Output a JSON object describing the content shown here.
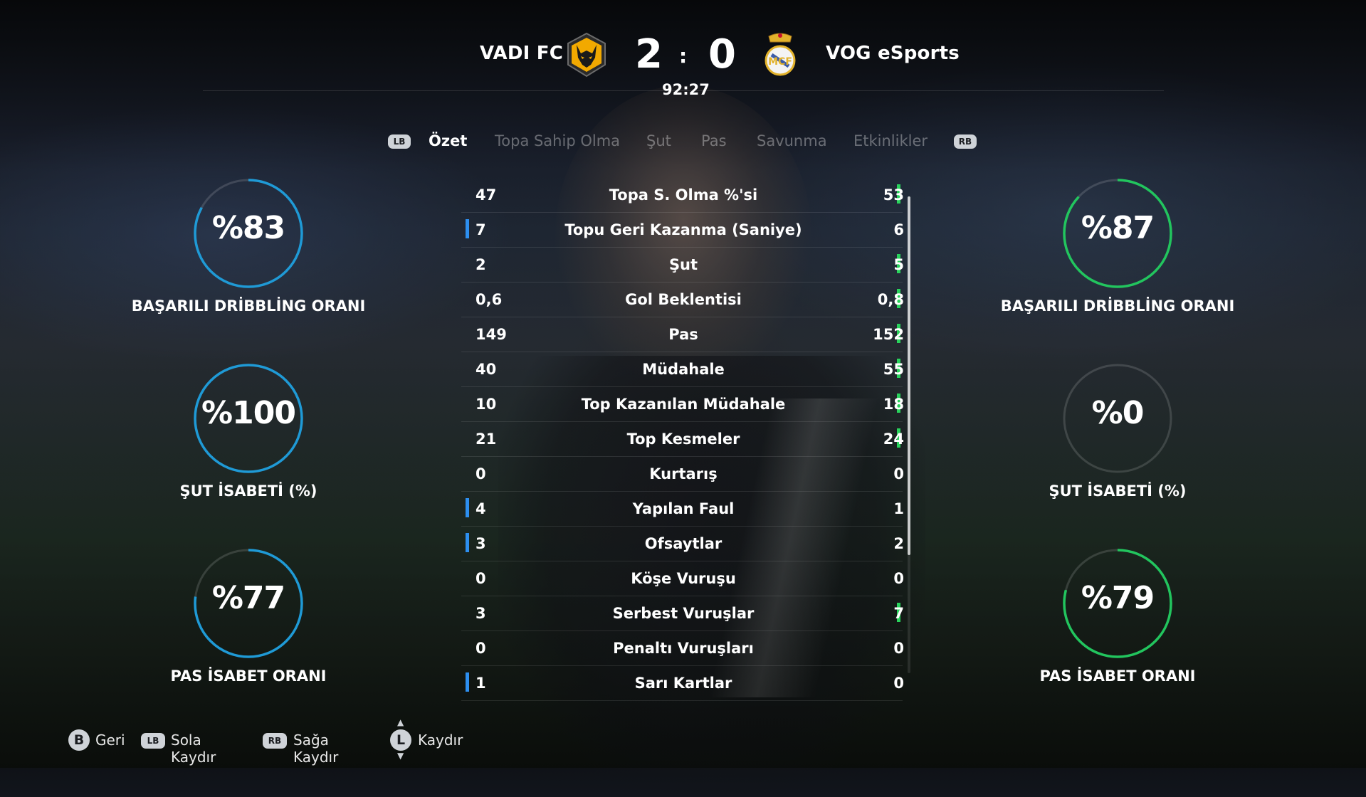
{
  "header": {
    "home_team": "VADI FC",
    "away_team": "VOG eSports",
    "home_score": "2",
    "away_score": "0",
    "separator": ":",
    "clock": "92:27",
    "home_crest_icon": "wolf-crest-icon",
    "away_crest_icon": "real-madrid-crest-icon"
  },
  "tabs": {
    "prev_button": "LB",
    "next_button": "RB",
    "items": [
      {
        "label": "Özet",
        "active": true
      },
      {
        "label": "Topa Sahip Olma",
        "active": false
      },
      {
        "label": "Şut",
        "active": false
      },
      {
        "label": "Pas",
        "active": false
      },
      {
        "label": "Savunma",
        "active": false
      },
      {
        "label": "Etkinlikler",
        "active": false
      }
    ]
  },
  "stats": [
    {
      "label": "Topa S. Olma %'si",
      "home": "47",
      "away": "53",
      "leader": "away"
    },
    {
      "label": "Topu Geri Kazanma (Saniye)",
      "home": "7",
      "away": "6",
      "leader": "home"
    },
    {
      "label": "Şut",
      "home": "2",
      "away": "5",
      "leader": "away"
    },
    {
      "label": "Gol Beklentisi",
      "home": "0,6",
      "away": "0,8",
      "leader": "away"
    },
    {
      "label": "Pas",
      "home": "149",
      "away": "152",
      "leader": "away"
    },
    {
      "label": "Müdahale",
      "home": "40",
      "away": "55",
      "leader": "away"
    },
    {
      "label": "Top Kazanılan Müdahale",
      "home": "10",
      "away": "18",
      "leader": "away"
    },
    {
      "label": "Top Kesmeler",
      "home": "21",
      "away": "24",
      "leader": "away"
    },
    {
      "label": "Kurtarış",
      "home": "0",
      "away": "0",
      "leader": "none"
    },
    {
      "label": "Yapılan Faul",
      "home": "4",
      "away": "1",
      "leader": "home"
    },
    {
      "label": "Ofsaytlar",
      "home": "3",
      "away": "2",
      "leader": "home"
    },
    {
      "label": "Köşe Vuruşu",
      "home": "0",
      "away": "0",
      "leader": "none"
    },
    {
      "label": "Serbest Vuruşlar",
      "home": "3",
      "away": "7",
      "leader": "away"
    },
    {
      "label": "Penaltı Vuruşları",
      "home": "0",
      "away": "0",
      "leader": "none"
    },
    {
      "label": "Sarı Kartlar",
      "home": "1",
      "away": "0",
      "leader": "home"
    }
  ],
  "gauges": {
    "home": [
      {
        "value_text": "%83",
        "label": "BAŞARILI DRİBBLİNG ORANI",
        "fraction": 0.83
      },
      {
        "value_text": "%100",
        "label": "ŞUT İSABETİ (%)",
        "fraction": 1.0
      },
      {
        "value_text": "%77",
        "label": "PAS İSABET ORANI",
        "fraction": 0.77
      }
    ],
    "away": [
      {
        "value_text": "%87",
        "label": "BAŞARILI DRİBBLİNG ORANI",
        "fraction": 0.87
      },
      {
        "value_text": "%0",
        "label": "ŞUT İSABETİ (%)",
        "fraction": 0.0
      },
      {
        "value_text": "%79",
        "label": "PAS İSABET ORANI",
        "fraction": 0.79
      }
    ]
  },
  "colors": {
    "home_accent": "#2d8ff0",
    "away_accent": "#29d35c",
    "home_gauge": "#1f9ad6",
    "away_gauge": "#22c55e"
  },
  "footer": {
    "back": {
      "button": "B",
      "label": "Geri"
    },
    "scroll_left": {
      "button": "LB",
      "label": "Sola Kaydır"
    },
    "scroll_right": {
      "button": "RB",
      "label": "Sağa Kaydır"
    },
    "scroll": {
      "button": "L",
      "label": "Kaydır"
    }
  }
}
